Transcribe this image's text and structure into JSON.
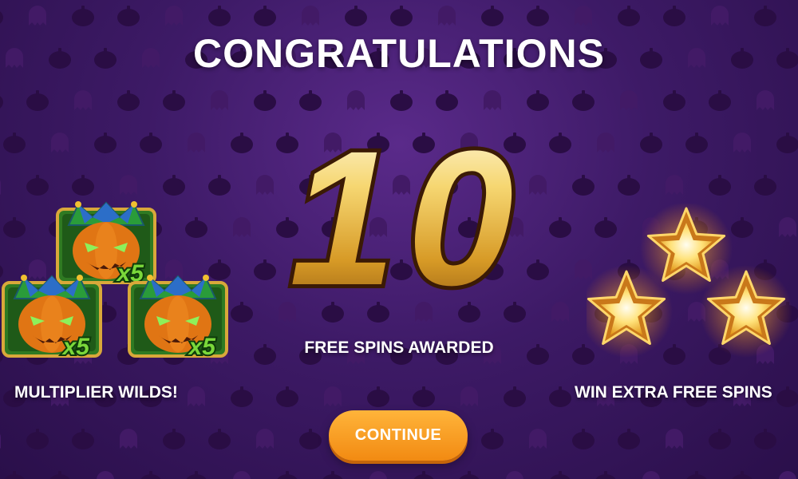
{
  "screen": {
    "title": "CONGRATULATIONS",
    "free_spins_count": "10",
    "free_spins_label": "FREE SPINS AWARDED",
    "left_feature_label": "MULTIPLIER WILDS!",
    "right_feature_label": "WIN EXTRA FREE SPINS",
    "continue_label": "CONTINUE"
  },
  "wild_symbol": {
    "icon": "jester-pumpkin-icon",
    "multiplier": "x5",
    "count": 3
  },
  "stars": {
    "icon": "gold-star-icon",
    "count": 3
  },
  "background": {
    "icons": [
      "pumpkin-icon",
      "ghost-icon"
    ]
  },
  "colors": {
    "background": "#3d1a66",
    "button": "#f7971c",
    "gold": "#f3c24a",
    "multiplier": "#7ad83a",
    "text": "#ffffff"
  }
}
